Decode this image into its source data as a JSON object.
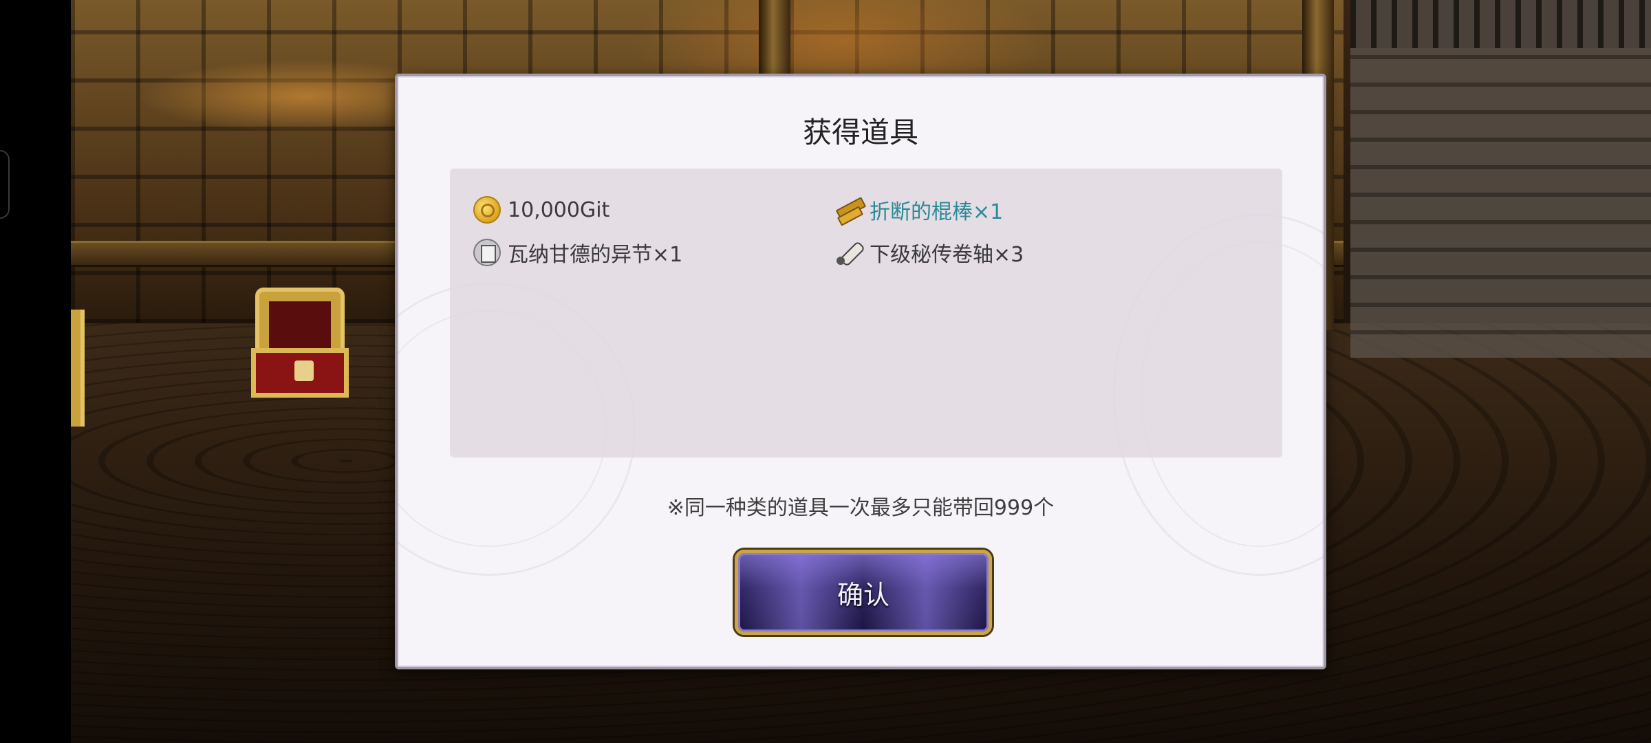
{
  "dialog": {
    "title": "获得道具",
    "items": [
      {
        "icon": "coin-icon",
        "label": "10,000Git",
        "color": "#3a3a3a"
      },
      {
        "icon": "broken-stick-icon",
        "label": "折断的棍棒×1",
        "color": "#2a8a96"
      },
      {
        "icon": "book-icon",
        "label": "瓦纳甘德的异节×1",
        "color": "#3a3a3a"
      },
      {
        "icon": "scroll-icon",
        "label": "下级秘传卷轴×3",
        "color": "#3a3a3a"
      }
    ],
    "note": "※同一种类的道具一次最多只能带回999个",
    "confirm_label": "确认"
  }
}
